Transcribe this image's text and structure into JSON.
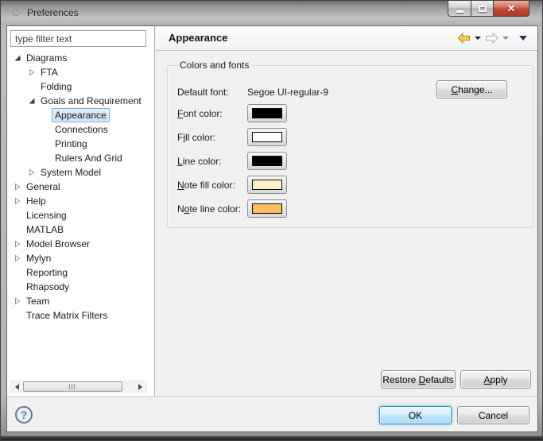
{
  "window": {
    "title": "Preferences",
    "controls": {
      "minimize": "minimize",
      "maximize": "maximize",
      "close": "close"
    }
  },
  "sidebar": {
    "filter_text": "type filter text",
    "tree": [
      {
        "label": "Diagrams",
        "level": 0,
        "arrow": "expanded"
      },
      {
        "label": "FTA",
        "level": 1,
        "arrow": "collapsed"
      },
      {
        "label": "Folding",
        "level": 1,
        "arrow": "none"
      },
      {
        "label": "Goals and Requirement",
        "level": 1,
        "arrow": "expanded"
      },
      {
        "label": "Appearance",
        "level": 2,
        "arrow": "none",
        "selected": true
      },
      {
        "label": "Connections",
        "level": 2,
        "arrow": "none"
      },
      {
        "label": "Printing",
        "level": 2,
        "arrow": "none"
      },
      {
        "label": "Rulers And Grid",
        "level": 2,
        "arrow": "none"
      },
      {
        "label": "System Model",
        "level": 1,
        "arrow": "collapsed"
      },
      {
        "label": "General",
        "level": 0,
        "arrow": "collapsed"
      },
      {
        "label": "Help",
        "level": 0,
        "arrow": "collapsed"
      },
      {
        "label": "Licensing",
        "level": 0,
        "arrow": "none"
      },
      {
        "label": "MATLAB",
        "level": 0,
        "arrow": "none"
      },
      {
        "label": "Model Browser",
        "level": 0,
        "arrow": "collapsed"
      },
      {
        "label": "Mylyn",
        "level": 0,
        "arrow": "collapsed"
      },
      {
        "label": "Reporting",
        "level": 0,
        "arrow": "none"
      },
      {
        "label": "Rhapsody",
        "level": 0,
        "arrow": "none"
      },
      {
        "label": "Team",
        "level": 0,
        "arrow": "collapsed"
      },
      {
        "label": "Trace Matrix Filters",
        "level": 0,
        "arrow": "none"
      }
    ]
  },
  "header": {
    "title": "Appearance"
  },
  "main": {
    "group_title": "Colors and fonts",
    "default_font": {
      "label": "Default font:",
      "value": "Segoe UI-regular-9"
    },
    "change_button": {
      "pre": "",
      "key": "C",
      "post": "hange..."
    },
    "color_rows": [
      {
        "name": "font-color",
        "label": {
          "pre": "",
          "key": "F",
          "post": "ont color:"
        },
        "color": "#000000"
      },
      {
        "name": "fill-color",
        "label": {
          "pre": "F",
          "key": "i",
          "post": "ll color:"
        },
        "color": "#ffffff"
      },
      {
        "name": "line-color",
        "label": {
          "pre": "",
          "key": "L",
          "post": "ine color:"
        },
        "color": "#000000"
      },
      {
        "name": "note-fill-color",
        "label": {
          "pre": "",
          "key": "N",
          "post": "ote fill color:"
        },
        "color": "#fbf1c6"
      },
      {
        "name": "note-line-color",
        "label": {
          "pre": "N",
          "key": "o",
          "post": "te line color:"
        },
        "color": "#fbbe5e"
      }
    ],
    "restore_button": {
      "pre": "Restore ",
      "key": "D",
      "post": "efaults"
    },
    "apply_button": {
      "pre": "",
      "key": "A",
      "post": "pply"
    }
  },
  "footer": {
    "ok": "OK",
    "cancel": "Cancel",
    "help": "?"
  },
  "colors": {
    "selection_bg": "#dcebfc",
    "selection_border": "#7da2ce",
    "back_arrow": "#f3cd5a",
    "view_menu_caret": "#32325c",
    "ok_border": "#3c7fb1"
  }
}
